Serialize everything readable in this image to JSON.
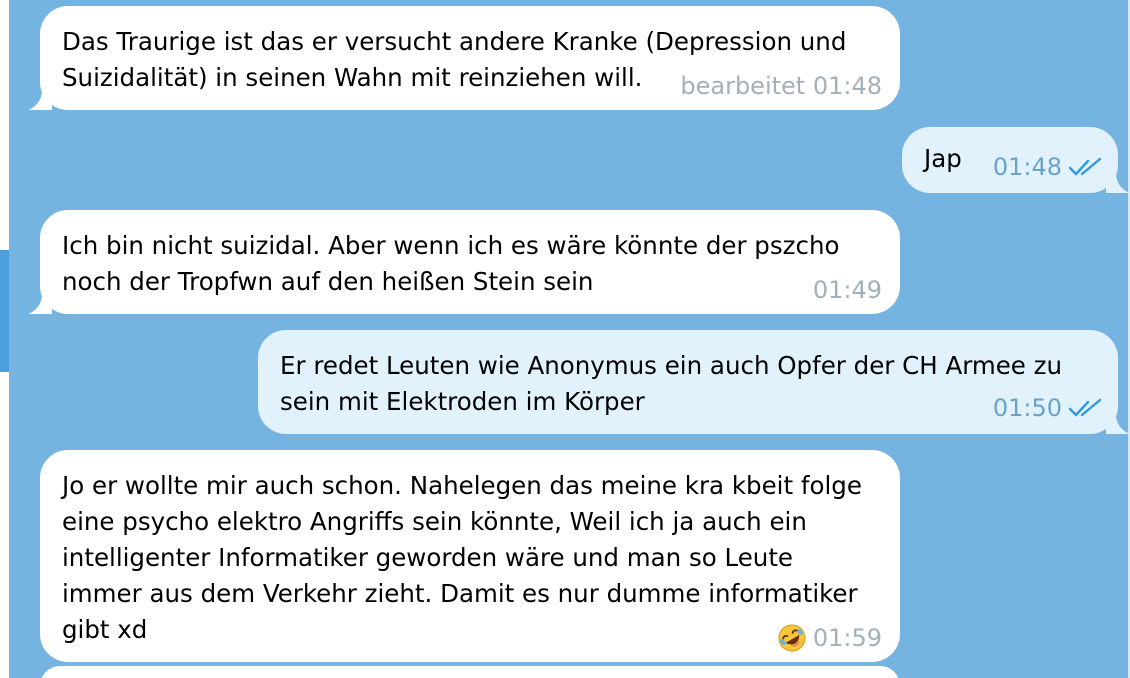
{
  "messages": [
    {
      "direction": "incoming",
      "text": "Das Traurige ist das er versucht andere Kranke (Depression und\nSuizidalität) in seinen Wahn mit reinziehen will.",
      "time": "bearbeitet 01:48"
    },
    {
      "direction": "outgoing",
      "text": "Jap",
      "time": "01:48",
      "status_icon": "double-check-icon"
    },
    {
      "direction": "incoming",
      "text": "Ich bin nicht suizidal. Aber wenn ich es wäre könnte der pszcho\nnoch der Tropfwn auf den heißen Stein sein",
      "time": "01:49"
    },
    {
      "direction": "outgoing",
      "text": "Er redet Leuten wie Anonymus ein auch Opfer der CH Armee zu\nsein mit Elektroden im Körper",
      "time": "01:50",
      "status_icon": "double-check-icon"
    },
    {
      "direction": "incoming",
      "text": "Jo er wollte mir auch schon. Nahelegen das meine kra kbeit folge\neine psycho elektro Angriffs sein könnte, Weil ich ja auch ein\nintelligenter Informatiker geworden wäre und man so Leute\nimmer aus dem Verkehr zieht. Damit es nur dumme informatiker\ngibt xd",
      "time": "01:59",
      "reaction_icon": "rolling-on-floor-laughing-emoji-icon"
    }
  ],
  "colors": {
    "background": "#75b3e0",
    "incoming_bubble": "#ffffff",
    "outgoing_bubble": "#e2f2fd",
    "check_color": "#2f9ae0"
  }
}
